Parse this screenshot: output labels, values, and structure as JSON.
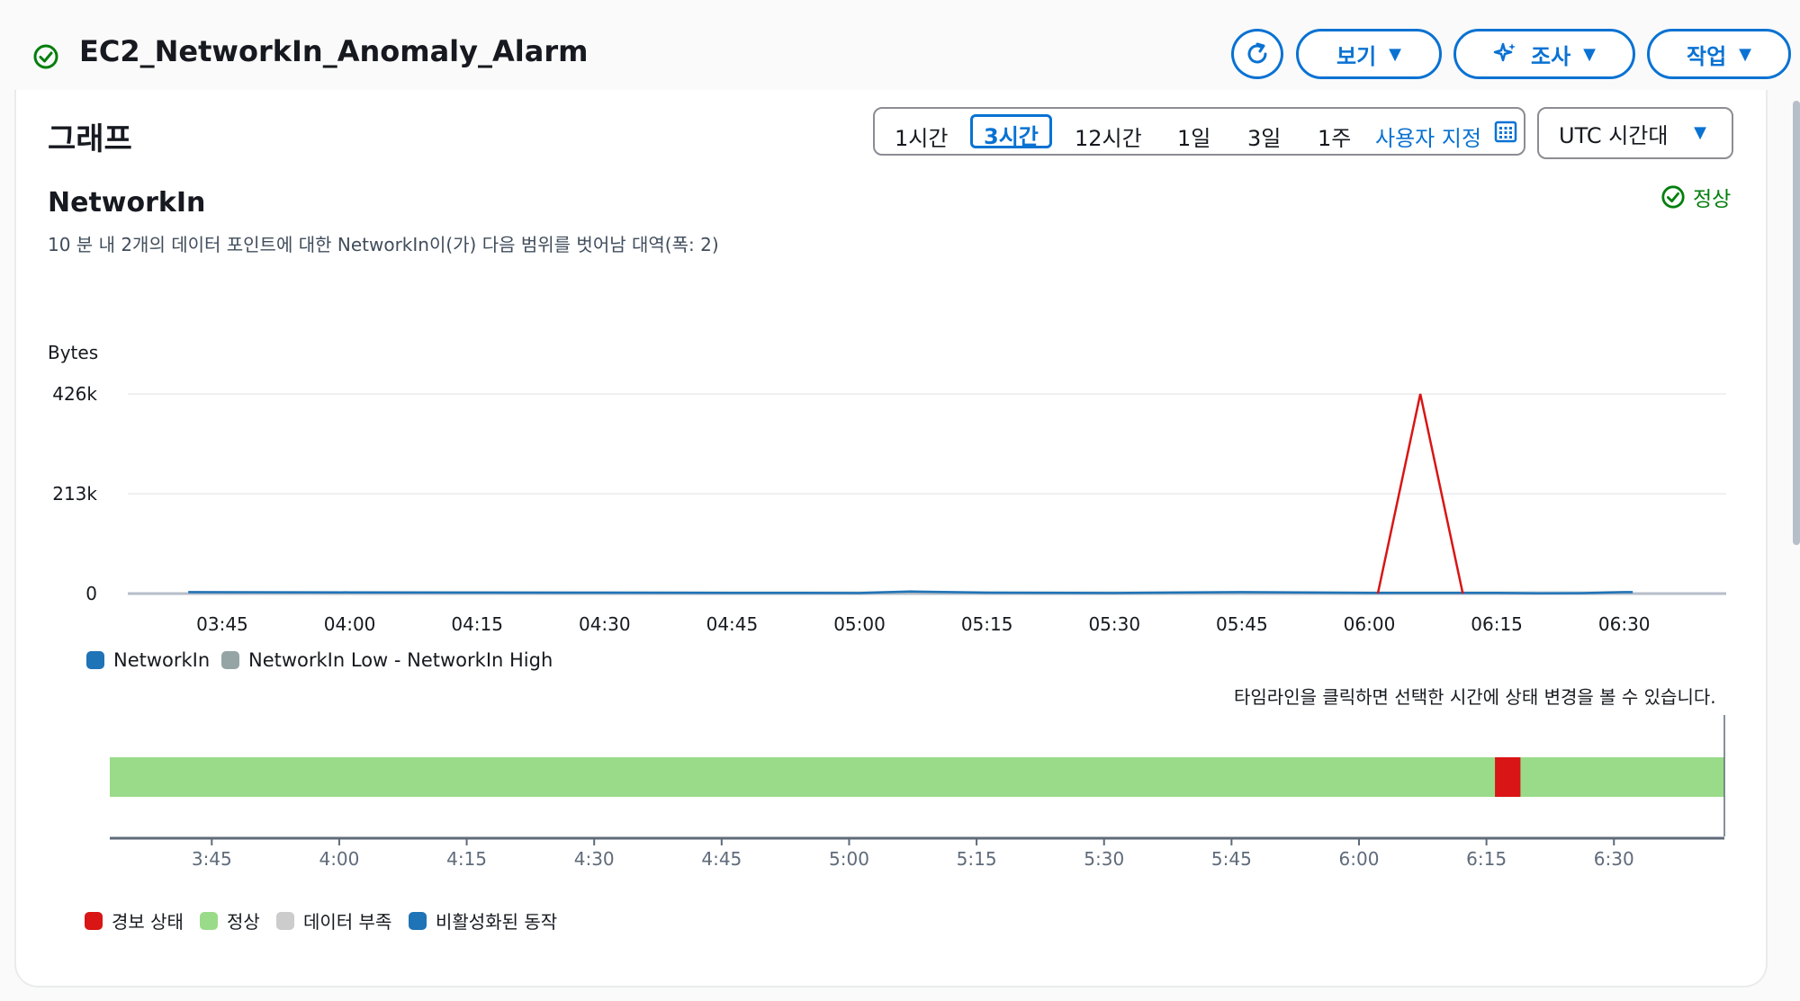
{
  "header": {
    "title": "EC2_NetworkIn_Anomaly_Alarm",
    "status_color": "#037f0c",
    "refresh_icon": "refresh-icon",
    "view_label": "보기",
    "investigate_label": "조사",
    "actions_label": "작업"
  },
  "graph": {
    "title": "그래프",
    "range_options": [
      "1시간",
      "3시간",
      "12시간",
      "1일",
      "3일",
      "1주"
    ],
    "selected_range": "3시간",
    "custom_label": "사용자 지정",
    "timezone": "UTC 시간대",
    "metric_title": "NetworkIn",
    "metric_desc": "10 분 내 2개의 데이터 포인트에 대한 NetworkIn이(가) 다음 범위를 벗어남 대역(폭: 2)",
    "status_label": "정상",
    "timeline_hint": "타임라인을 클릭하면 선택한 시간에 상태 변경을 볼 수 있습니다."
  },
  "chart_data": {
    "type": "line",
    "ylabel": "Bytes",
    "yticks": [
      "0",
      "213k",
      "426k"
    ],
    "ylim": [
      0,
      426000
    ],
    "xticks": [
      "03:45",
      "04:00",
      "04:15",
      "04:30",
      "04:45",
      "05:00",
      "05:15",
      "05:30",
      "05:45",
      "06:00",
      "06:15",
      "06:30"
    ],
    "series": [
      {
        "name": "NetworkIn",
        "color": "#1f73b7",
        "points": [
          [
            "03:41",
            3000
          ],
          [
            "04:00",
            2500
          ],
          [
            "04:15",
            2200
          ],
          [
            "04:30",
            1800
          ],
          [
            "04:45",
            1500
          ],
          [
            "05:00",
            1200
          ],
          [
            "05:06",
            4500
          ],
          [
            "05:15",
            1800
          ],
          [
            "05:30",
            1200
          ],
          [
            "05:45",
            3000
          ],
          [
            "06:00",
            1500
          ],
          [
            "06:05",
            1500
          ],
          [
            "06:15",
            1500
          ],
          [
            "06:20",
            800
          ],
          [
            "06:25",
            1000
          ],
          [
            "06:30",
            3000
          ],
          [
            "06:31",
            3000
          ]
        ]
      },
      {
        "name": "NetworkIn Low - NetworkIn High",
        "color": "#95a5a6",
        "band_high": 6000,
        "band_low": 0
      }
    ],
    "alarm_segment": {
      "color": "#d91515",
      "points": [
        [
          "06:01",
          0
        ],
        [
          "06:06",
          426000
        ],
        [
          "06:11",
          0
        ]
      ]
    },
    "grid": true
  },
  "timeline": {
    "xticks": [
      "3:45",
      "4:00",
      "4:15",
      "4:30",
      "4:45",
      "5:00",
      "5:15",
      "5:30",
      "5:45",
      "6:00",
      "6:15",
      "6:30"
    ],
    "normal_color": "#9adb8a",
    "alarm_color": "#d91515",
    "alarm_start": "06:16",
    "alarm_end": "06:19"
  },
  "legend": {
    "items": [
      {
        "label": "NetworkIn",
        "color": "#1f73b7"
      },
      {
        "label": "NetworkIn Low - NetworkIn High",
        "color": "#95a5a6"
      }
    ]
  },
  "state_legend": {
    "items": [
      {
        "label": "경보 상태",
        "color": "#d91515"
      },
      {
        "label": "정상",
        "color": "#9adb8a"
      },
      {
        "label": "데이터 부족",
        "color": "#cccccc"
      },
      {
        "label": "비활성화된 동작",
        "color": "#1f73b7"
      }
    ]
  }
}
